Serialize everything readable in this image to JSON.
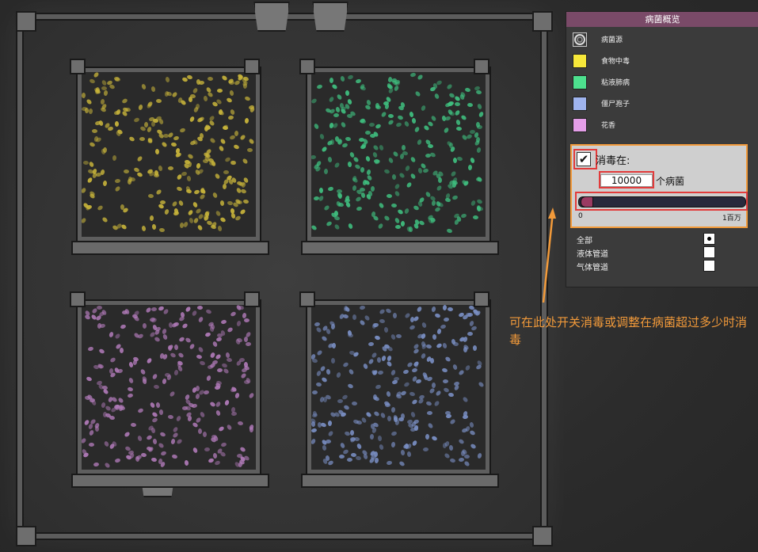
{
  "overlay": {
    "title": "病菌概览",
    "legend": [
      {
        "label": "病菌源",
        "color": "#d0d0d0",
        "icon": "germ-source-icon"
      },
      {
        "label": "食物中毒",
        "color": "#f7e83a"
      },
      {
        "label": "粘液肺病",
        "color": "#4de08e"
      },
      {
        "label": "僵尸孢子",
        "color": "#9fb4ee"
      },
      {
        "label": "花香",
        "color": "#e49ee8"
      }
    ]
  },
  "disinfect": {
    "checked": true,
    "label": "消毒在:",
    "threshold_value": "10000",
    "threshold_unit": "个病菌",
    "slider_min_label": "0",
    "slider_max_label": "1百万",
    "slider_fraction": 0.01
  },
  "filters": [
    {
      "label": "全部",
      "selected": true
    },
    {
      "label": "液体管道",
      "selected": false
    },
    {
      "label": "气体管道",
      "selected": false
    }
  ],
  "annotation": {
    "text": "可在此处开关消毒或调整在病菌超过多少时消毒",
    "color": "#f29a3a"
  },
  "rooms": [
    {
      "name": "food-poisoning-room",
      "germ_color": "#c8b43a"
    },
    {
      "name": "slimelung-room",
      "germ_color": "#3fbf7f"
    },
    {
      "name": "floral-scent-room",
      "germ_color": "#b07ab8"
    },
    {
      "name": "zombie-spores-room",
      "germ_color": "#7a8fc4"
    }
  ]
}
